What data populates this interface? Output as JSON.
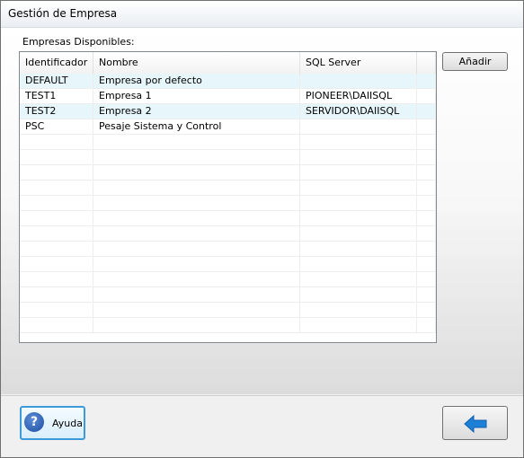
{
  "window": {
    "title": "Gestión de Empresa"
  },
  "companies": {
    "label": "Empresas Disponibles:",
    "columns": [
      "Identificador",
      "Nombre",
      "SQL Server"
    ],
    "rows": [
      {
        "id": "DEFAULT",
        "name": "Empresa por defecto",
        "server": ""
      },
      {
        "id": "TEST1",
        "name": "Empresa 1",
        "server": "PIONEER\\DAIISQL"
      },
      {
        "id": "TEST2",
        "name": "Empresa 2",
        "server": "SERVIDOR\\DAIISQL"
      },
      {
        "id": "PSC",
        "name": "Pesaje Sistema y Control",
        "server": ""
      }
    ]
  },
  "buttons": {
    "add": "Añadir",
    "help": "Ayuda"
  },
  "icons": {
    "help": "question-icon",
    "back": "back-arrow-icon"
  },
  "colors": {
    "row_alt": "#e6f6fb",
    "accent": "#3c9ad8",
    "arrow": "#1e7fd6"
  }
}
